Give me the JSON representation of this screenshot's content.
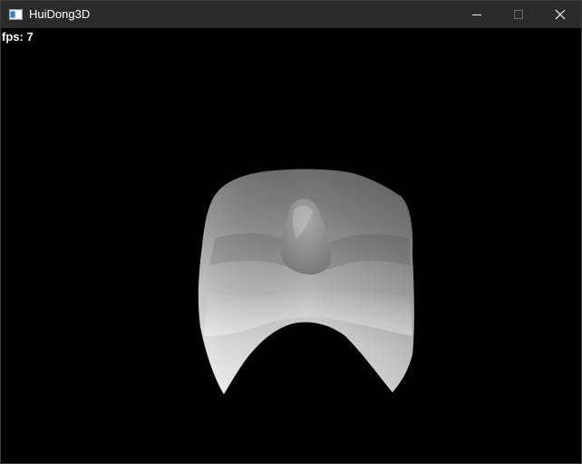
{
  "window": {
    "title": "HuiDong3D"
  },
  "overlay": {
    "fps_text": "fps: 7"
  },
  "titlebar_buttons": {
    "minimize_icon": "minimize-icon",
    "maximize_icon": "maximize-icon",
    "close_icon": "close-icon"
  },
  "colors": {
    "titlebar_bg": "#2b2b2b",
    "viewport_bg": "#000000",
    "overlay_text": "#ffffff"
  }
}
